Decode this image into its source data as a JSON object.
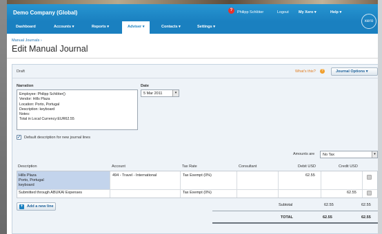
{
  "header": {
    "company": "Demo Company (Global)",
    "help_badge": "?",
    "user": "Philipp Schlöter",
    "logout": "Logout",
    "my_xero": "My Xero ▾",
    "help": "Help ▾",
    "logo": "xero"
  },
  "nav": {
    "tabs": [
      "Dashboard",
      "Accounts ▾",
      "Reports ▾",
      "Adviser ▾",
      "Contacts ▾",
      "Settings ▾"
    ],
    "active": "Adviser ▾"
  },
  "breadcrumb": "Manual Journals ›",
  "title": "Edit Manual Journal",
  "panel": {
    "status": "Draft",
    "whats_this": "What's this?",
    "journal_options": "Journal Options ▾"
  },
  "form": {
    "narration_label": "Narration",
    "narration_lines": [
      "Employee: Philipp Schlöter()",
      "Vendor: Hills Plaza",
      "Location: Porto, Portugal",
      "Description: keyboard",
      "Notes:",
      "Total in Local Currency:EUR62.55"
    ],
    "date_label": "Date",
    "date_value": "5 Mar 2011",
    "default_desc_checked": true,
    "default_desc_label": "Default description for new journal lines",
    "amounts_are_label": "Amounts are",
    "amounts_are_value": "No Tax"
  },
  "grid": {
    "columns": [
      "Description",
      "Account",
      "Tax Rate",
      "Consultant",
      "Debit USD",
      "Credit USD"
    ],
    "rows": [
      {
        "description": [
          "Hills Plaza",
          "Porto, Portugal",
          "keyboard"
        ],
        "account": "494 - Travel - International",
        "tax_rate": "Tax Exempt (0%)",
        "consultant": "",
        "debit": "62.55",
        "credit": ""
      },
      {
        "description": [
          "Submitted through ABUKAI Expenses"
        ],
        "account": "",
        "tax_rate": "Tax Exempt (0%)",
        "consultant": "",
        "debit": "",
        "credit": "62.55"
      }
    ]
  },
  "add_line": "Add a new line",
  "totals": {
    "subtotal_label": "Subtotal",
    "subtotal_debit": "62.55",
    "subtotal_credit": "62.55",
    "total_label": "TOTAL",
    "total_debit": "62.55",
    "total_credit": "62.55"
  }
}
